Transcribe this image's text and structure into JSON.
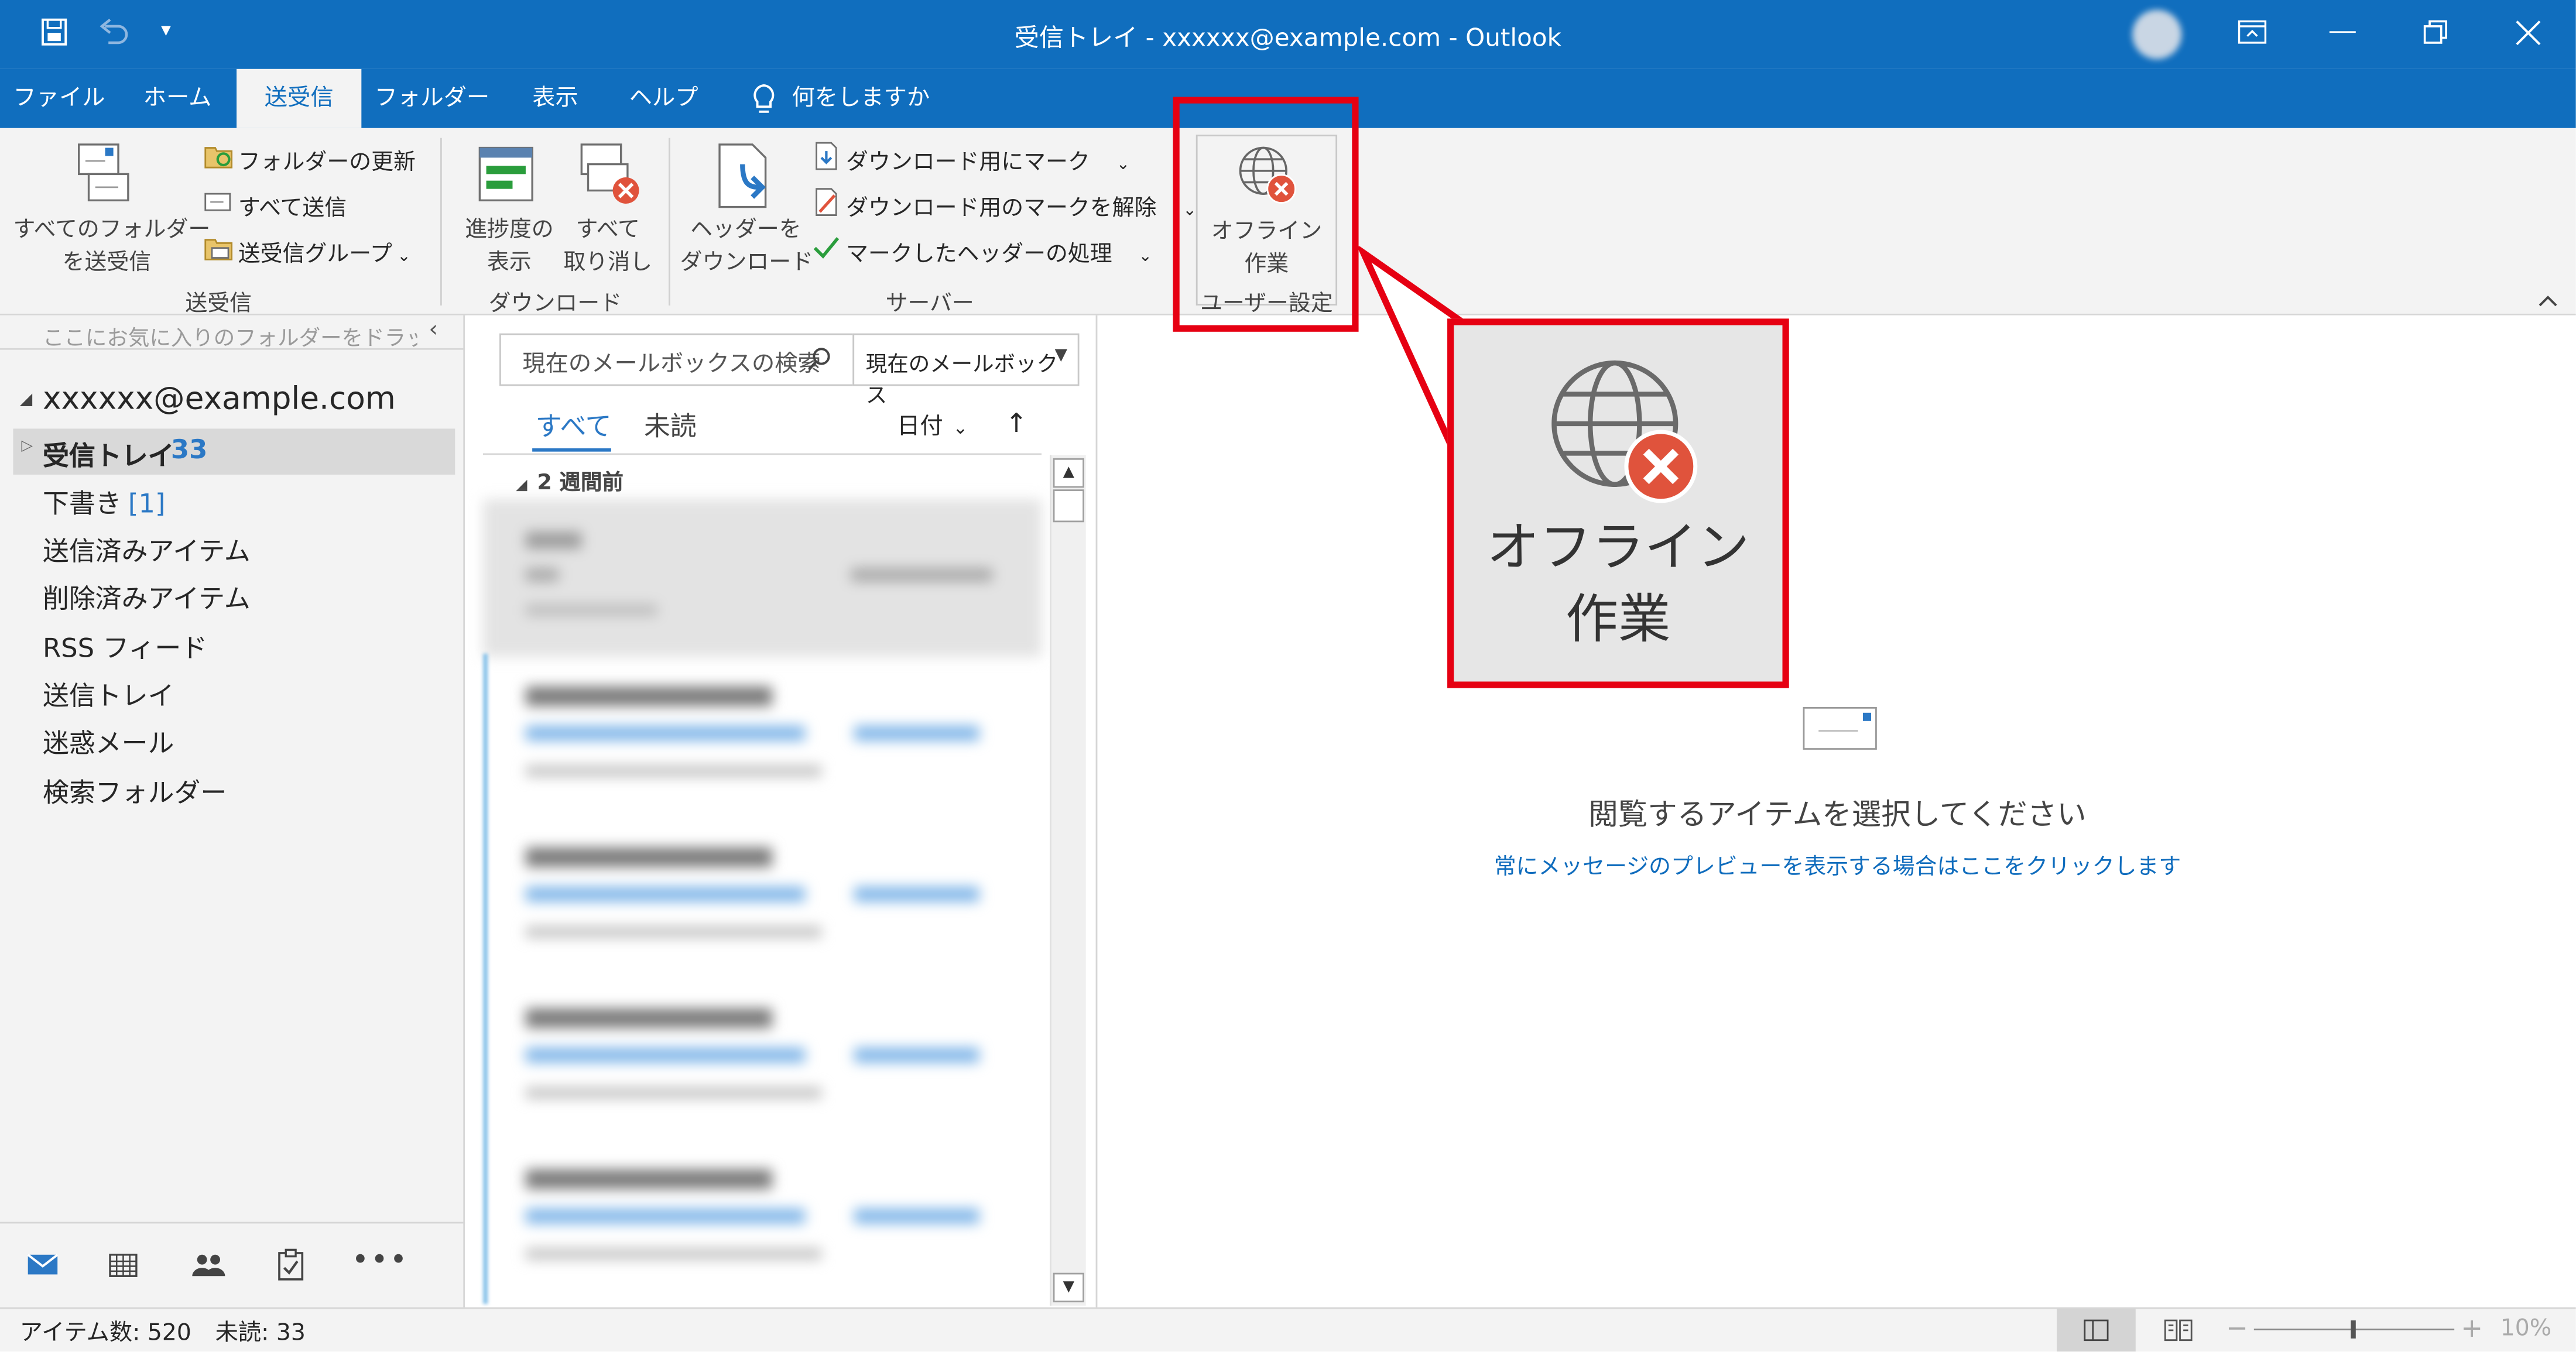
{
  "window": {
    "title": "受信トレイ - xxxxxx@example.com  -  Outlook",
    "qat_more": "▾"
  },
  "tabs": [
    {
      "label": "ファイル"
    },
    {
      "label": "ホーム"
    },
    {
      "label": "送受信",
      "active": true
    },
    {
      "label": "フォルダー"
    },
    {
      "label": "表示"
    },
    {
      "label": "ヘルプ"
    }
  ],
  "tell_me": "何をしますか",
  "ribbon": {
    "send_receive_all": [
      "すべてのフォルダー",
      "を送受信"
    ],
    "update_folder": "フォルダーの更新",
    "send_all": "すべて送信",
    "send_receive_groups": "送受信グループ",
    "group_send_receive": "送受信",
    "show_progress": [
      "進捗度の",
      "表示"
    ],
    "cancel_all": [
      "すべて",
      "取り消し"
    ],
    "group_download": "ダウンロード",
    "download_headers": [
      "ヘッダーを",
      "ダウンロード"
    ],
    "mark_to_download": "ダウンロード用にマーク",
    "unmark_to_download": "ダウンロード用のマークを解除",
    "process_marked_headers": "マークしたヘッダーの処理",
    "group_server": "サーバー",
    "work_offline": [
      "オフライン",
      "作業"
    ],
    "group_preferences": "ユーザー設定"
  },
  "callout": {
    "label": [
      "オフライン",
      "作業"
    ]
  },
  "nav": {
    "favorites_hint": "ここにお気に入りのフォルダーをドラッグしま",
    "account": "xxxxxx@example.com",
    "folders": [
      {
        "name": "受信トレイ",
        "count": "33",
        "selected": true
      },
      {
        "name": "下書き",
        "count": "[1]"
      },
      {
        "name": "送信済みアイテム"
      },
      {
        "name": "削除済みアイテム"
      },
      {
        "name": "RSS フィード"
      },
      {
        "name": "送信トレイ"
      },
      {
        "name": "迷惑メール"
      },
      {
        "name": "検索フォルダー"
      }
    ]
  },
  "list": {
    "search_placeholder": "現在のメールボックスの検索",
    "scope": "現在のメールボックス",
    "filter_all": "すべて",
    "filter_unread": "未読",
    "sort": "日付",
    "group_header": "2 週間前"
  },
  "reading": {
    "empty_message": "閲覧するアイテムを選択してください",
    "preview_link": "常にメッセージのプレビューを表示する場合はここをクリックします"
  },
  "status": {
    "items": "アイテム数: 520",
    "unread": "未読: 33",
    "zoom": "10%"
  },
  "colors": {
    "accent": "#106ebe",
    "highlight": "#e60012",
    "link": "#0f6cbd"
  }
}
